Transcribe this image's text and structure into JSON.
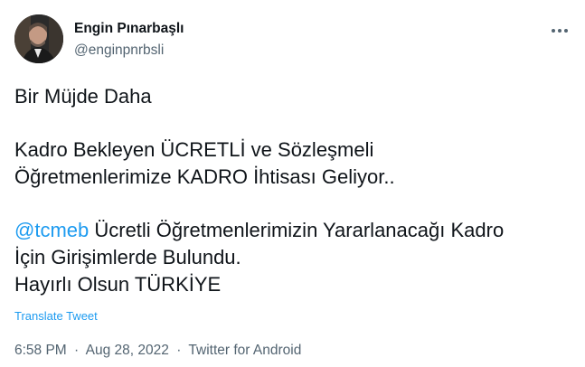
{
  "author": {
    "display_name": "Engin Pınarbaşlı",
    "handle": "@enginpnrbsli"
  },
  "actions": {
    "more_icon": "more-horizontal-icon"
  },
  "tweet": {
    "line1": "Bir Müjde Daha",
    "line2": "Kadro Bekleyen ÜCRETLİ ve Sözleşmeli",
    "line3": "Öğretmenlerimize KADRO İhtisası Geliyor..",
    "mention": "@tcmeb",
    "line4_rest": " Ücretli Öğretmenlerimizin Yararlanacağı Kadro",
    "line5": "İçin Girişimlerde Bulundu.",
    "line6": "Hayırlı Olsun TÜRKİYE"
  },
  "translate_label": "Translate Tweet",
  "meta": {
    "time": "6:58 PM",
    "separator": "·",
    "date": "Aug 28, 2022",
    "source": "Twitter for Android"
  },
  "colors": {
    "link": "#1d9bf0",
    "secondary_text": "#536471",
    "primary_text": "#0f1419"
  }
}
